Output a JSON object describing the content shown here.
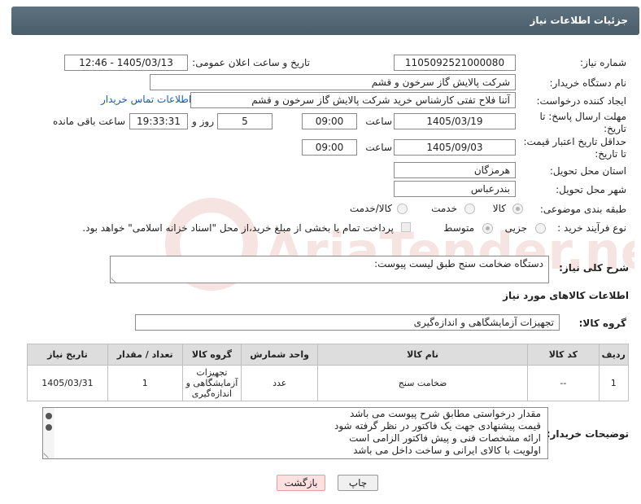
{
  "header": {
    "title": "جزئیات اطلاعات نیاز"
  },
  "form": {
    "need_number_label": "شماره نیاز:",
    "need_number": "1105092521000080",
    "announce_label": "تاریخ و ساعت اعلان عمومی:",
    "announce_value": "1405/03/13 - 12:46",
    "buyer_org_label": "نام دستگاه خریدار:",
    "buyer_org": "شرکت پالایش گاز سرخون و قشم",
    "requester_label": "ایجاد کننده درخواست:",
    "requester": "آتنا فلاح تفتی کارشناس خرید شرکت پالایش گاز سرخون و قشم",
    "contact_link": "اطلاعات تماس خریدار",
    "deadline_label": "مهلت ارسال پاسخ: تا تاریخ:",
    "deadline_date": "1405/03/19",
    "time_label": "ساعت",
    "deadline_time": "09:00",
    "days_value": "5",
    "days_label": "روز و",
    "remaining_time": "19:33:31",
    "remaining_label": "ساعت باقی مانده",
    "validity_label": "حداقل تاریخ اعتبار قیمت: تا تاریخ:",
    "validity_date": "1405/09/03",
    "validity_time": "09:00",
    "province_label": "استان محل تحویل:",
    "province": "هرمزگان",
    "city_label": "شهر محل تحویل:",
    "city": "بندرعباس",
    "category_label": "طبقه بندی موضوعی:",
    "category_options": [
      "کالا",
      "خدمت",
      "کالا/خدمت"
    ],
    "process_label": "نوع فرآیند خرید :",
    "process_options": [
      "جزیی",
      "متوسط"
    ],
    "payment_note": "پرداخت تمام یا بخشی از مبلغ خرید،از محل \"اسناد خزانه اسلامی\" خواهد بود."
  },
  "description": {
    "label": "شرح کلی نیاز:",
    "value": "دستگاه ضخامت سنج طبق لیست پیوست:"
  },
  "goods": {
    "section_title": "اطلاعات کالاهای مورد نیاز",
    "group_label": "گروه کالا:",
    "group_value": "تجهیزات آزمایشگاهی و اندازه‌گیری"
  },
  "table": {
    "headers": [
      "ردیف",
      "کد کالا",
      "نام کالا",
      "واحد شمارش",
      "گروه کالا",
      "تعداد / مقدار",
      "تاریخ نیاز"
    ],
    "rows": [
      [
        "1",
        "--",
        "ضخامت سنج",
        "عدد",
        "تجهیزات آزمایشگاهی و اندازه‌گیری",
        "1",
        "1405/03/31"
      ]
    ]
  },
  "notes": {
    "label": "توضیحات خریدار:",
    "lines": [
      "مقدار درخواستی مطابق شرح پیوست می باشد",
      "قیمت پیشنهادی جهت یک فاکتور در نظر گرفته شود",
      "ارائه مشخصات فنی و پیش فاکتور الزامی است",
      "اولویت با کالای ایرانی و ساخت داخل می باشد"
    ]
  },
  "buttons": {
    "print": "چاپ",
    "back": "بازگشت"
  },
  "watermark": {
    "text": "AriaTender.net"
  },
  "colors": {
    "header_bg": "#55697a",
    "link": "#1a5ab8",
    "back_bg": "#fde0e0",
    "print_bg": "#f0f0f0",
    "watermark": "#c0392b"
  }
}
